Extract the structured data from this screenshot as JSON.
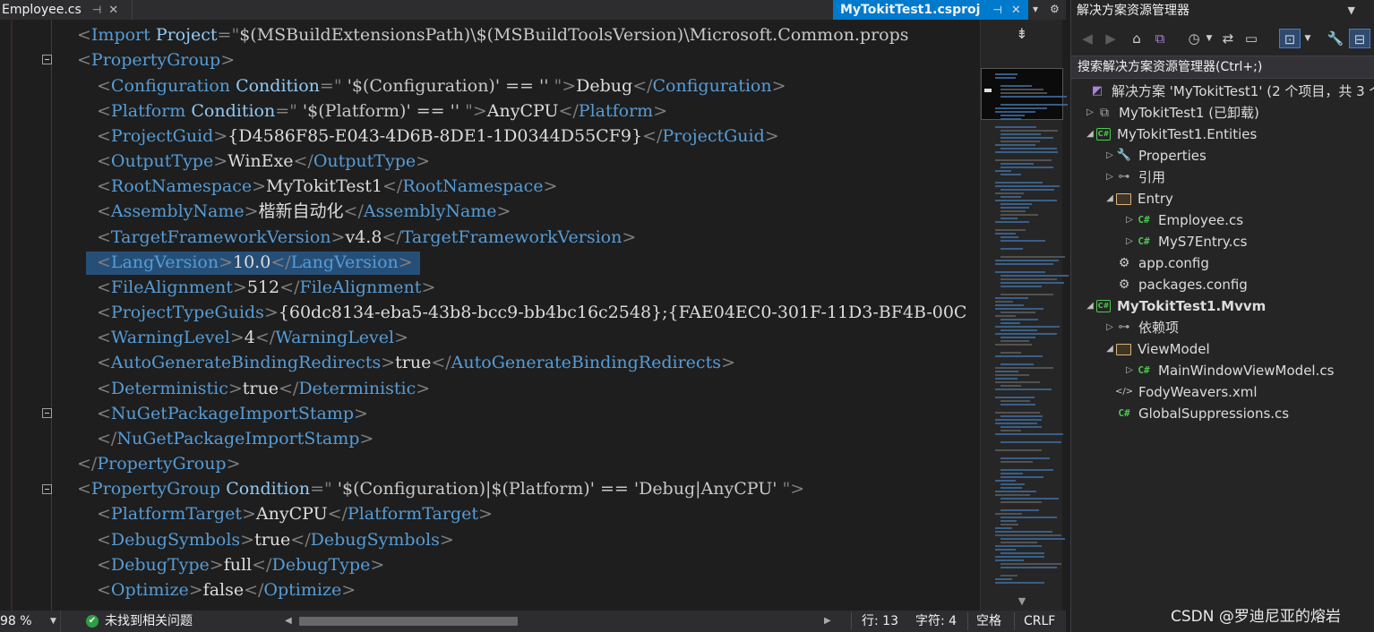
{
  "tabs": {
    "left_tab": "Employee.cs",
    "active_tab": "MyTokitTest1.csproj"
  },
  "code_lines": [
    "<Import Project=\"$(MSBuildExtensionsPath)\\$(MSBuildToolsVersion)\\Microsoft.Common.props",
    "<PropertyGroup>",
    "<Configuration Condition=\" '$(Configuration)' == '' \">Debug</Configuration>",
    "<Platform Condition=\" '$(Platform)' == '' \">AnyCPU</Platform>",
    "<ProjectGuid>{D4586F85-E043-4D6B-8DE1-1D0344D55CF9}</ProjectGuid>",
    "<OutputType>WinExe</OutputType>",
    "<RootNamespace>MyTokitTest1</RootNamespace>",
    "<AssemblyName>楷新自动化</AssemblyName>",
    "<TargetFrameworkVersion>v4.8</TargetFrameworkVersion>",
    "<LangVersion>10.0</LangVersion>",
    "<FileAlignment>512</FileAlignment>",
    "<ProjectTypeGuids>{60dc8134-eba5-43b8-bcc9-bb4bc16c2548};{FAE04EC0-301F-11D3-BF4B-00C",
    "<WarningLevel>4</WarningLevel>",
    "<AutoGenerateBindingRedirects>true</AutoGenerateBindingRedirects>",
    "<Deterministic>true</Deterministic>",
    "<NuGetPackageImportStamp>",
    "</NuGetPackageImportStamp>",
    "</PropertyGroup>",
    "<PropertyGroup Condition=\" '$(Configuration)|$(Platform)' == 'Debug|AnyCPU' \">",
    "<PlatformTarget>AnyCPU</PlatformTarget>",
    "<DebugSymbols>true</DebugSymbols>",
    "<DebugType>full</DebugType>",
    "<Optimize>false</Optimize>"
  ],
  "status": {
    "zoom": "98 %",
    "issues": "未找到相关问题",
    "line": "行: 13",
    "char": "字符: 4",
    "spaces": "空格",
    "line_ending": "CRLF"
  },
  "solution_explorer": {
    "title": "解决方案资源管理器",
    "search_placeholder": "搜索解决方案资源管理器(Ctrl+;)",
    "tree": [
      {
        "label": "解决方案 'MyTokitTest1' (2 个项目，共 3 个",
        "icon": "solution-icon"
      },
      {
        "label": "MyTokitTest1 (已卸载)",
        "icon": "unloaded-project-icon"
      },
      {
        "label": "MyTokitTest1.Entities",
        "icon": "csharp-project-icon"
      },
      {
        "label": "Properties",
        "icon": "wrench-icon"
      },
      {
        "label": "引用",
        "icon": "references-icon"
      },
      {
        "label": "Entry",
        "icon": "folder-icon"
      },
      {
        "label": "Employee.cs",
        "icon": "csharp-file-icon"
      },
      {
        "label": "MyS7Entry.cs",
        "icon": "csharp-file-icon"
      },
      {
        "label": "app.config",
        "icon": "config-file-icon"
      },
      {
        "label": "packages.config",
        "icon": "config-file-icon"
      },
      {
        "label": "MyTokitTest1.Mvvm",
        "icon": "csharp-project-icon"
      },
      {
        "label": "依赖项",
        "icon": "dependencies-icon"
      },
      {
        "label": "ViewModel",
        "icon": "folder-icon"
      },
      {
        "label": "MainWindowViewModel.cs",
        "icon": "csharp-file-icon"
      },
      {
        "label": "FodyWeavers.xml",
        "icon": "xml-file-icon"
      },
      {
        "label": "GlobalSuppressions.cs",
        "icon": "csharp-file-icon"
      }
    ]
  },
  "watermark": "CSDN @罗迪尼亚的熔岩",
  "colors": {
    "accent": "#007acc",
    "tag": "#569cd6",
    "attribute": "#92caf4",
    "delimiter": "#808080",
    "selection": "#264f78"
  }
}
